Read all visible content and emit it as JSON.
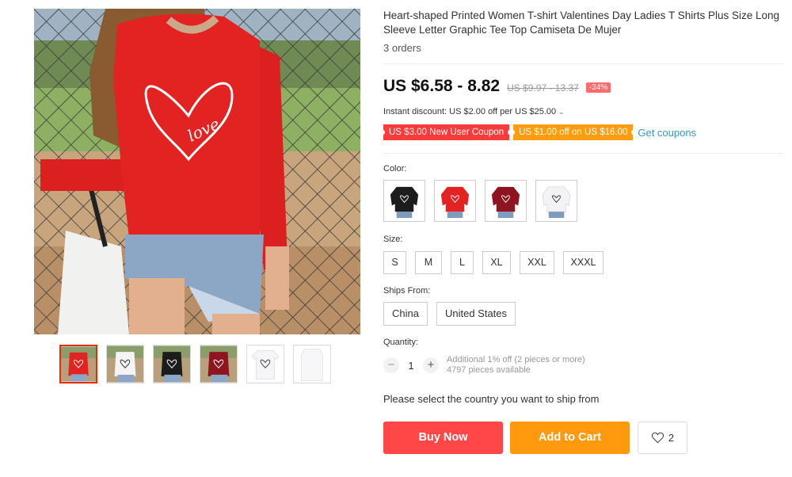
{
  "product": {
    "title": "Heart-shaped Printed Women T-shirt Valentines Day Ladies T Shirts Plus Size Long Sleeve Letter Graphic Tee Top Camiseta De Mujer",
    "orders": "3 orders",
    "price": "US $6.58 - 8.82",
    "original_price": "US $9.97 - 13.37",
    "discount_pct": "-34%",
    "instant_discount": "Instant discount: US $2.00 off per US $25.00",
    "print_text": "love"
  },
  "coupons": {
    "new_user": "US $3.00 New User Coupon",
    "off": "US $1.00 off on US $16.00",
    "get_coupons": "Get coupons"
  },
  "labels": {
    "color": "Color:",
    "size": "Size:",
    "ships_from": "Ships From:",
    "quantity": "Quantity:"
  },
  "colors": [
    "black",
    "red",
    "burgundy",
    "white"
  ],
  "sizes": [
    "S",
    "M",
    "L",
    "XL",
    "XXL",
    "XXXL"
  ],
  "ships_from": [
    "China",
    "United States"
  ],
  "quantity": {
    "value": "1",
    "minus": "−",
    "plus": "+",
    "note_line1": "Additional 1% off (2 pieces or more)",
    "note_line2": "4797 pieces available"
  },
  "ship_message": "Please select the country you want to ship from",
  "actions": {
    "buy_now": "Buy Now",
    "add_to_cart": "Add to Cart",
    "wish_count": "2"
  },
  "theme": {
    "buy_color": "#ff4747",
    "cart_color": "#ff9a0e",
    "coupon_red": "#fb3b3b",
    "coupon_orange": "#ff9c0f",
    "link_color": "#2e9cc3",
    "active_thumb_border": "#e62e04"
  },
  "icons": [
    "heart-icon",
    "chevron-down-icon",
    "minus-icon",
    "plus-icon"
  ]
}
